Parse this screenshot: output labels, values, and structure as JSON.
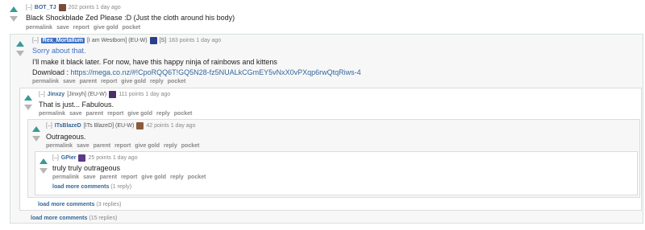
{
  "colors": {
    "upvote": "#3a9a95",
    "downvote": "#b6b6b6",
    "link": "#336699",
    "submitter_bg": "#3c70c6"
  },
  "link_labels": [
    "permalink",
    "save",
    "parent",
    "report",
    "give gold",
    "reply",
    "pocket"
  ],
  "c1": {
    "collapse": "[–]",
    "author": "BOT_TJ",
    "score": "202 points 1 day ago",
    "body": "Black Shockblade Zed Please :D (Just the cloth around his body)",
    "links": [
      "permalink",
      "save",
      "report",
      "give gold",
      "pocket"
    ]
  },
  "c2": {
    "collapse": "[–]",
    "author": "Rex_Mortallum",
    "flair": "[I am Westborn] (EU-W)",
    "badge": "[S]",
    "score": "183 points 1 day ago",
    "line1": "Sorry about that.",
    "line2": "I'll make it black later. For now, have this happy ninja of rainbows and kittens",
    "line3_prefix": "Download : ",
    "line3_link": "https://mega.co.nz/#!CpoRQQ6T!GQ5N28-fz5NUALkCGmEY5vNxX0vPXqp6rwQtqRiws-4"
  },
  "c3": {
    "collapse": "[–]",
    "author": "Jinxzy",
    "flair": "[Jinxyh] (EU-W)",
    "score": "111 points 1 day ago",
    "body": "That is just... Fabulous."
  },
  "c4": {
    "collapse": "[–]",
    "author": "ITsBlazeD",
    "flair": "[ITs BlazeD] (EU-W)",
    "score": "42 points 1 day ago",
    "body": "Outrageous."
  },
  "c5": {
    "collapse": "[–]",
    "author": "GPier",
    "score": "25 points 1 day ago",
    "body": "truly truly outrageous",
    "more_link": "load more comments",
    "more_count": "(1 reply)"
  },
  "more3": {
    "link": "load more comments",
    "count": "(3 replies)"
  },
  "more15": {
    "link": "load more comments",
    "count": "(15 replies)"
  }
}
